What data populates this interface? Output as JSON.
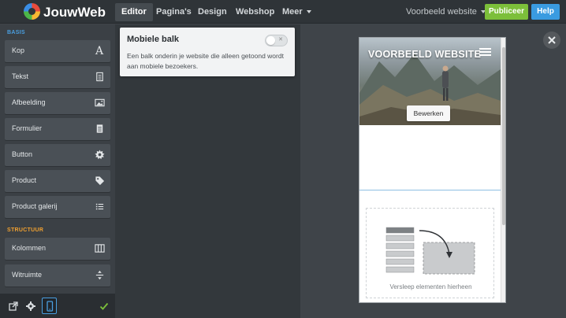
{
  "topbar": {
    "brand": "JouwWeb",
    "nav": [
      {
        "label": "Editor",
        "active": true
      },
      {
        "label": "Pagina's",
        "active": false
      },
      {
        "label": "Design",
        "active": false
      },
      {
        "label": "Webshop",
        "active": false
      },
      {
        "label": "Meer",
        "active": false
      }
    ],
    "site_select": "Voorbeeld website",
    "publish_label": "Publiceer",
    "help_label": "Help"
  },
  "sidebar": {
    "section_basis": "BASIS",
    "section_structuur": "STRUCTUUR",
    "basis_items": [
      {
        "label": "Kop",
        "icon": "heading-icon"
      },
      {
        "label": "Tekst",
        "icon": "text-document-icon"
      },
      {
        "label": "Afbeelding",
        "icon": "image-icon"
      },
      {
        "label": "Formulier",
        "icon": "form-icon"
      },
      {
        "label": "Button",
        "icon": "button-burst-icon"
      },
      {
        "label": "Product",
        "icon": "tag-icon"
      },
      {
        "label": "Product galerij",
        "icon": "list-icon"
      }
    ],
    "structuur_items": [
      {
        "label": "Kolommen",
        "icon": "columns-icon"
      },
      {
        "label": "Witruimte",
        "icon": "spacing-icon"
      }
    ]
  },
  "bottombar": {
    "icons": [
      "external-link-icon",
      "settings-icon",
      "mobile-icon",
      "checkmark-icon"
    ],
    "active": "mobile-icon"
  },
  "popup": {
    "title": "Mobiele balk",
    "description": "Een balk onderin je website die alleen getoond wordt aan mobiele bezoekers.",
    "toggle_on": false
  },
  "preview": {
    "hero_title": "VOORBEELD WEBSITE",
    "edit_button": "Bewerken",
    "drop_text": "Versleep elementen hierheen"
  },
  "colors": {
    "publish": "#7cbf3a",
    "help": "#3a9be0",
    "section_basis": "#4a9fe0",
    "section_structuur": "#f0a030"
  }
}
